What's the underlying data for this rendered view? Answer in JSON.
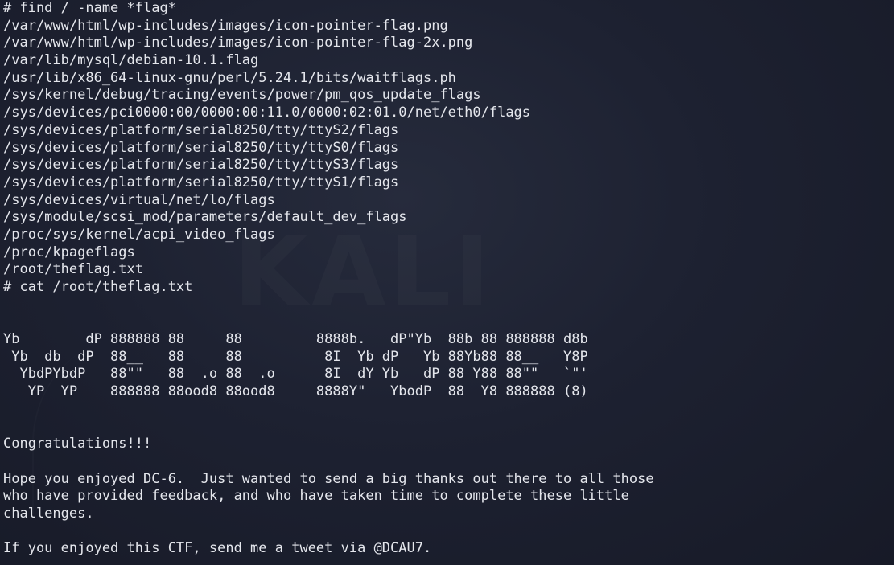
{
  "terminal": {
    "prompt1": "# find / -name *flag*",
    "find_results": [
      "/var/www/html/wp-includes/images/icon-pointer-flag.png",
      "/var/www/html/wp-includes/images/icon-pointer-flag-2x.png",
      "/var/lib/mysql/debian-10.1.flag",
      "/usr/lib/x86_64-linux-gnu/perl/5.24.1/bits/waitflags.ph",
      "/sys/kernel/debug/tracing/events/power/pm_qos_update_flags",
      "/sys/devices/pci0000:00/0000:00:11.0/0000:02:01.0/net/eth0/flags",
      "/sys/devices/platform/serial8250/tty/ttyS2/flags",
      "/sys/devices/platform/serial8250/tty/ttyS0/flags",
      "/sys/devices/platform/serial8250/tty/ttyS3/flags",
      "/sys/devices/platform/serial8250/tty/ttyS1/flags",
      "/sys/devices/virtual/net/lo/flags",
      "/sys/module/scsi_mod/parameters/default_dev_flags",
      "/proc/sys/kernel/acpi_video_flags",
      "/proc/kpageflags",
      "/root/theflag.txt"
    ],
    "prompt2": "# cat /root/theflag.txt",
    "ascii_art": [
      "Yb        dP 888888 88     88         8888b.   dP\"Yb  88b 88 888888 d8b",
      " Yb  db  dP  88__   88     88          8I  Yb dP   Yb 88Yb88 88__   Y8P",
      "  YbdPYbdP   88\"\"   88  .o 88  .o      8I  dY Yb   dP 88 Y88 88\"\"   `\"'",
      "   YP  YP    888888 88ood8 88ood8     8888Y\"   YbodP  88  Y8 888888 (8)"
    ],
    "congrats": "Congratulations!!!",
    "message_lines": [
      "Hope you enjoyed DC-6.  Just wanted to send a big thanks out there to all those",
      "who have provided feedback, and who have taken time to complete these little",
      "challenges."
    ],
    "tweet_line": "If you enjoyed this CTF, send me a tweet via @DCAU7."
  }
}
